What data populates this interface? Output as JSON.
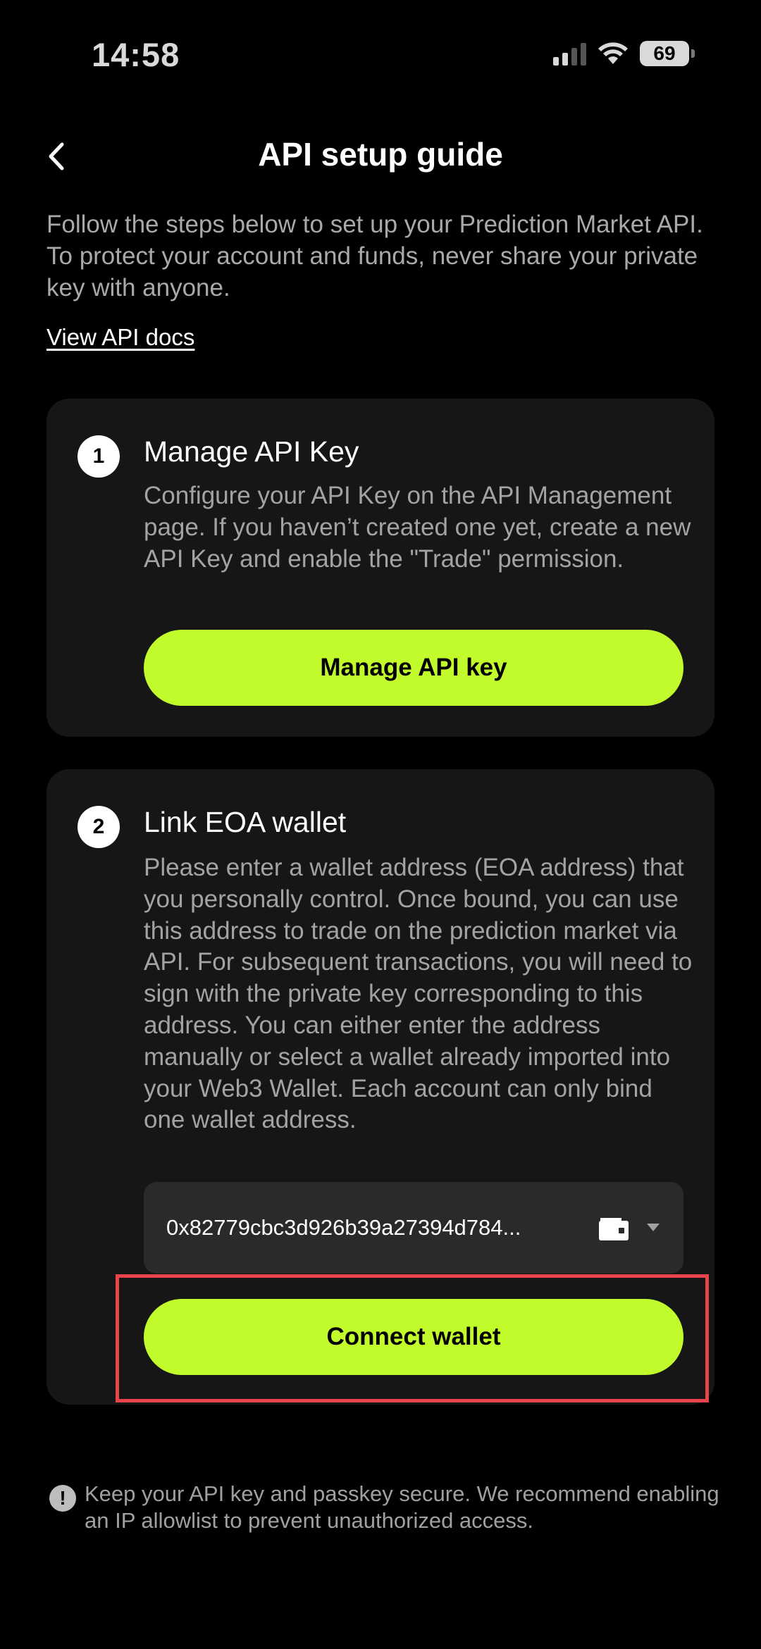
{
  "status_bar": {
    "time": "14:58",
    "battery": "69",
    "signal_bars_active": 2,
    "signal_bars_total": 4
  },
  "header": {
    "title": "API setup guide",
    "back_icon": "chevron-left-icon"
  },
  "intro": {
    "text": "Follow the steps below to set up your Prediction Market API. To protect your account and funds, never share your private key with anyone.",
    "docs_link": "View API docs"
  },
  "steps": [
    {
      "number": "1",
      "title": "Manage API Key",
      "description": "Configure your API Key on the API Management page. If you haven’t created one yet, create a new API Key and enable the \"Trade\" permission.",
      "button_label": "Manage API key"
    },
    {
      "number": "2",
      "title": "Link EOA wallet",
      "description": "Please enter a wallet address (EOA address) that you personally control. Once bound, you can use this address to trade on the prediction market via API. For subsequent transactions, you will need to sign with the private key corresponding to this address. You can either enter the address manually or select a wallet already imported into your Web3 Wallet. Each account can only bind one wallet address.",
      "wallet_address": "0x82779cbc3d926b39a27394d784...",
      "wallet_icon": "wallet-icon",
      "dropdown_icon": "caret-down-icon",
      "button_label": "Connect wallet"
    }
  ],
  "notice": {
    "icon": "exclamation-circle-icon",
    "text": "Keep your API key and passkey secure. We recommend enabling an IP allowlist to prevent unauthorized access."
  },
  "colors": {
    "background": "#000000",
    "card": "#161616",
    "accent": "#c2fb2c",
    "highlight": "#e5454b",
    "input": "#2a2a2a"
  }
}
